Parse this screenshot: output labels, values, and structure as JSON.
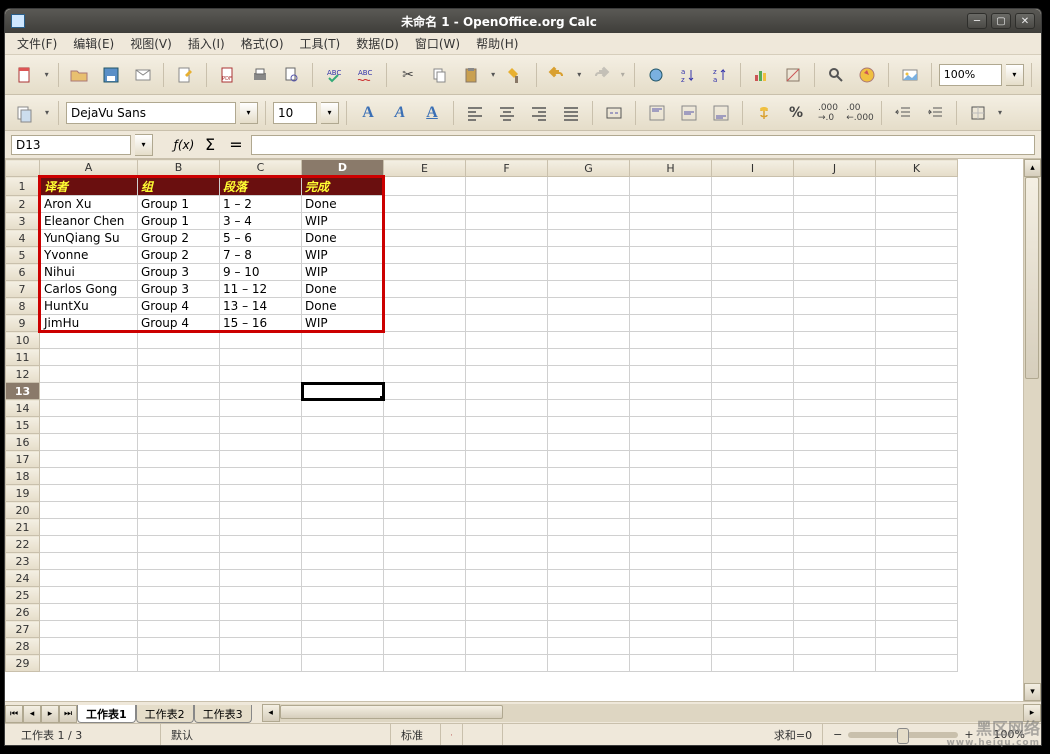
{
  "window": {
    "title": "未命名 1 - OpenOffice.org Calc"
  },
  "menu": [
    "文件(F)",
    "编辑(E)",
    "视图(V)",
    "插入(I)",
    "格式(O)",
    "工具(T)",
    "数据(D)",
    "窗口(W)",
    "帮助(H)"
  ],
  "toolbar": {
    "zoom": "100%"
  },
  "format": {
    "font": "DejaVu Sans",
    "size": "10"
  },
  "cellref": "D13",
  "columns": [
    "A",
    "B",
    "C",
    "D",
    "E",
    "F",
    "G",
    "H",
    "I",
    "J",
    "K"
  ],
  "rows_count": 29,
  "selected_cell": {
    "row": 13,
    "col": "D"
  },
  "headers": {
    "A": "译者",
    "B": "组",
    "C": "段落",
    "D": "完成"
  },
  "data_rows": [
    {
      "A": "Aron Xu",
      "B": "Group 1",
      "C": "1 – 2",
      "D": "Done"
    },
    {
      "A": "Eleanor Chen",
      "B": "Group 1",
      "C": "3 – 4",
      "D": "WIP"
    },
    {
      "A": "YunQiang Su",
      "B": "Group 2",
      "C": "5 – 6",
      "D": "Done"
    },
    {
      "A": "Yvonne",
      "B": "Group 2",
      "C": "7 – 8",
      "D": "WIP"
    },
    {
      "A": "Nihui",
      "B": "Group 3",
      "C": "9 – 10",
      "D": "WIP"
    },
    {
      "A": "Carlos Gong",
      "B": "Group 3",
      "C": "11 – 12",
      "D": "Done"
    },
    {
      "A": "HuntXu",
      "B": "Group 4",
      "C": "13 – 14",
      "D": "Done"
    },
    {
      "A": "JimHu",
      "B": "Group 4",
      "C": "15 – 16",
      "D": "WIP"
    }
  ],
  "tabs": [
    "工作表1",
    "工作表2",
    "工作表3"
  ],
  "status": {
    "sheet": "工作表 1 / 3",
    "style": "默认",
    "mode": "标准",
    "sum": "求和=0",
    "zoom": "100%"
  },
  "watermark": {
    "line1": "黑区网络",
    "line2": "www.heiqu.com"
  }
}
